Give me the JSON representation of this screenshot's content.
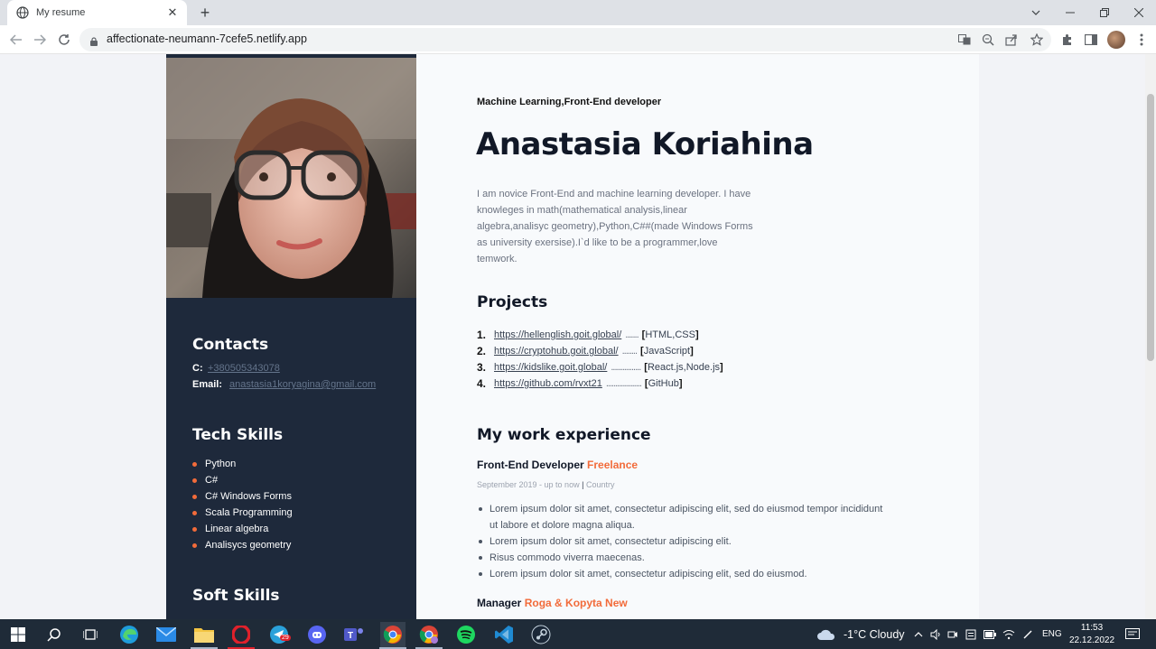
{
  "browser": {
    "tab_title": "My resume",
    "new_tab": "+",
    "close_tab": "✕",
    "url": "affectionate-neumann-7cefe5.netlify.app"
  },
  "sidebar": {
    "contacts_heading": "Contacts",
    "phone_label": "C:",
    "phone_value": "+380505343078",
    "email_label": "Email:",
    "email_value": "anastasia1koryagina@gmail.com",
    "tech_heading": "Tech Skills",
    "skills": [
      "Python",
      "C#",
      "C# Windows Forms",
      "Scala Programming",
      "Linear algebra",
      "Analisycs geometry"
    ],
    "soft_heading": "Soft Skills"
  },
  "main": {
    "subtitle": "Machine Learning,Front-End developer",
    "name": "Anastasia Koriahina",
    "about": "I am novice Front-End and machine learning developer. I have knowleges in math(mathematical analysis,linear algebra,analisyc geometry),Python,C##(made Windows Forms as university exersise).I`d like to be a programmer,love temwork.",
    "projects_heading": "Projects",
    "projects": [
      {
        "num": "1.",
        "url": "https://hellenglish.goit.global/",
        "dots": ".......",
        "tags": "HTML,CSS"
      },
      {
        "num": "2.",
        "url": "https://cryptohub.goit.global/",
        "dots": "........",
        "tags": "JavaScript"
      },
      {
        "num": "3.",
        "url": "https://kidslike.goit.global/",
        "dots": "................",
        "tags": "React.js,Node.js"
      },
      {
        "num": "4.",
        "url": "https://github.com/rvxt21",
        "dots": "...................",
        "tags": "GitHub"
      }
    ],
    "experience_heading": "My work experience",
    "job1": {
      "title": "Front-End Developer",
      "company": "Freelance",
      "date": "September 2019 - up to now",
      "sep": "|",
      "location": "Country",
      "duties": [
        "Lorem ipsum dolor sit amet, consectetur adipiscing elit, sed do eiusmod tempor incididunt ut labore et dolore magna aliqua.",
        "Lorem ipsum dolor sit amet, consectetur adipiscing elit.",
        "Risus commodo viverra maecenas.",
        "Lorem ipsum dolor sit amet, consectetur adipiscing elit, sed do eiusmod."
      ]
    },
    "job2": {
      "title": "Manager",
      "company": "Roga & Kopyta New"
    }
  },
  "taskbar": {
    "weather": "-1°C  Cloudy",
    "lang": "ENG",
    "time": "11:53",
    "date": "22.12.2022",
    "badge": "29"
  },
  "colors": {
    "sidebar": "#1e293b",
    "accent": "#f26b3a",
    "main_bg": "#f8fafc",
    "page_bg": "#f2f3f7"
  }
}
